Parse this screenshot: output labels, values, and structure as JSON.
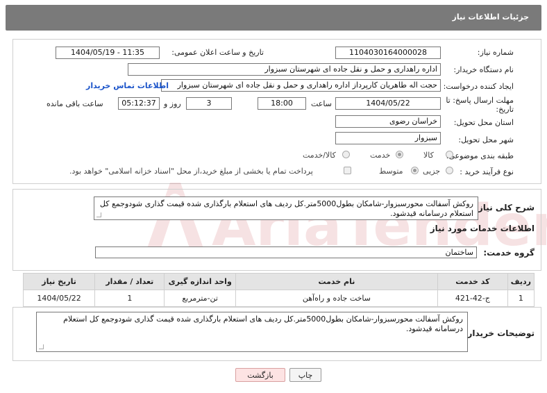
{
  "header": {
    "title": "جزئیات اطلاعات نیاز"
  },
  "fields": {
    "need_number": {
      "label": "شماره نیاز:",
      "value": "1104030164000028"
    },
    "announce_datetime": {
      "label": "تاریخ و ساعت اعلان عمومی:",
      "value": "1404/05/19 - 11:35"
    },
    "buyer_org": {
      "label": "نام دستگاه خریدار:",
      "value": "اداره راهداری و حمل و نقل جاده ای شهرستان سبزوار"
    },
    "requester": {
      "label": "ایجاد کننده درخواست:",
      "value": "حجت اله طاهریان کارپرداز اداره راهداری و حمل و نقل جاده ای شهرستان سبزوار",
      "contact_link": "اطلاعات تماس خریدار"
    },
    "deadline": {
      "label_line1": "مهلت ارسال پاسخ: تا",
      "label_line2": "تاریخ:",
      "date": "1404/05/22",
      "time_label": "ساعت",
      "time": "18:00",
      "days": "3",
      "days_label": "روز و",
      "remaining": "05:12:37",
      "remaining_label": "ساعت باقی مانده"
    },
    "province": {
      "label": "استان محل تحویل:",
      "value": "خراسان رضوی"
    },
    "city": {
      "label": "شهر محل تحویل:",
      "value": "سبزوار"
    },
    "category": {
      "label": "طبقه بندی موضوعی:",
      "options": [
        "کالا",
        "خدمت",
        "کالا/خدمت"
      ],
      "selected": "خدمت"
    },
    "purchase_type": {
      "label": "نوع فرآیند خرید :",
      "options": [
        "جزیی",
        "متوسط"
      ],
      "selected": "متوسط",
      "note": "پرداخت تمام یا بخشی از مبلغ خرید،از محل \"اسناد خزانه اسلامی\" خواهد بود."
    }
  },
  "summary": {
    "label": "شرح کلی نیاز:",
    "text": "روکش آسفالت محورسبزوار-شامکان بطول5000متر.کل ردیف های استعلام بارگذاری شده قیمت گذاری شودوجمع کل استعلام درسامانه قیدشود."
  },
  "services": {
    "section_title": "اطلاعات خدمات مورد نیاز",
    "group_label": "گروه خدمت:",
    "group_value": "ساختمان",
    "table": {
      "headers": [
        "ردیف",
        "کد خدمت",
        "نام خدمت",
        "واحد اندازه گیری",
        "تعداد / مقدار",
        "تاریخ نیاز"
      ],
      "rows": [
        [
          "1",
          "ج-42-421",
          "ساخت جاده و راه‌آهن",
          "تن-مترمربع",
          "1",
          "1404/05/22"
        ]
      ]
    }
  },
  "buyer_notes": {
    "label": "توضیحات خریدار:",
    "text": "روکش آسفالت محورسبزوار-شامکان بطول5000متر.کل ردیف های استعلام بارگذاری شده قیمت گذاری شودوجمع کل استعلام درسامانه قیدشود."
  },
  "buttons": {
    "print": "چاپ",
    "back": "بازگشت"
  },
  "watermark": {
    "logo_text": "AriaTender.net"
  },
  "colors": {
    "header_bg": "#7a7a7a",
    "link": "#1a53c9",
    "back_button": "#fde3e3",
    "watermark": "#c0282d"
  }
}
